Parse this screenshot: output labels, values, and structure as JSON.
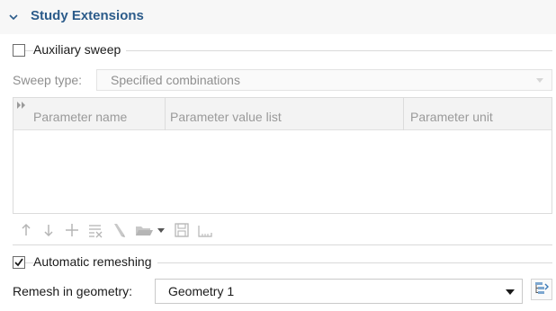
{
  "section": {
    "title": "Study Extensions",
    "icon": "chevron-down-icon"
  },
  "auxiliary_sweep": {
    "label": "Auxiliary sweep",
    "checked": false,
    "sweep_type_label": "Sweep type:",
    "sweep_type_value": "Specified combinations",
    "table": {
      "columns": [
        "Parameter name",
        "Parameter value list",
        "Parameter unit"
      ],
      "rows": []
    },
    "toolbar": [
      "move-up-icon",
      "move-down-icon",
      "add-icon",
      "clear-table-icon",
      "delete-icon",
      "load-from-file-icon",
      "dropdown-arrow-icon",
      "save-to-file-icon",
      "range-icon"
    ]
  },
  "automatic_remeshing": {
    "label": "Automatic remeshing",
    "checked": true,
    "remesh_label": "Remesh in geometry:",
    "remesh_value": "Geometry 1",
    "goto_button_icon": "go-to-source-icon"
  },
  "colors": {
    "section_title": "#2b5b8a",
    "disabled_text": "#8f8f8f",
    "toolbar_icon_disabled": "#b5b5b5"
  }
}
